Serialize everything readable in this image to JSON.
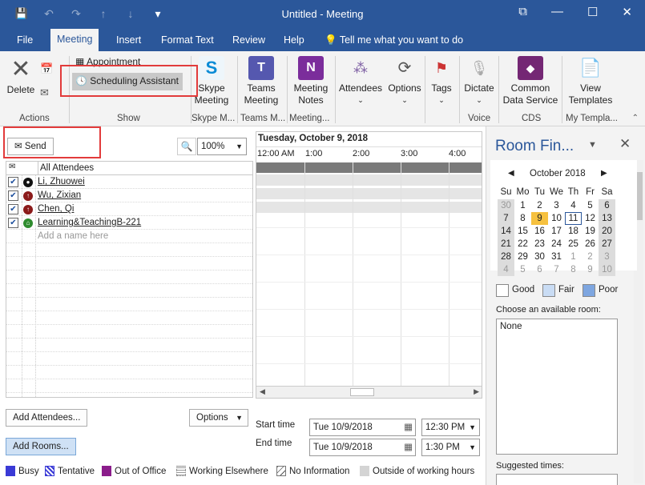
{
  "window": {
    "title": "Untitled  -  Meeting",
    "minimize": "—",
    "restore": "☐",
    "close": "✕",
    "ribbon_display": "⧉"
  },
  "qat": {
    "save": "💾",
    "undo": "↶",
    "redo": "↷",
    "up": "↑",
    "down": "↓",
    "more": "▾"
  },
  "tabs": [
    "File",
    "Meeting",
    "Insert",
    "Format Text",
    "Review",
    "Help"
  ],
  "tell_me": "Tell me what you want to do",
  "ribbon": {
    "delete": "Delete",
    "appointment": "Appointment",
    "scheduling_assistant": "Scheduling Assistant",
    "skype_meeting": [
      "Skype",
      "Meeting"
    ],
    "teams_meeting": [
      "Teams",
      "Meeting"
    ],
    "meeting_notes": [
      "Meeting",
      "Notes"
    ],
    "attendees": "Attendees",
    "options": "Options",
    "tags": "Tags",
    "dictate": "Dictate",
    "common_data": [
      "Common",
      "Data Service"
    ],
    "view_templates": [
      "View",
      "Templates"
    ],
    "groups": [
      "Actions",
      "Show",
      "Skype M...",
      "Teams M...",
      "Meeting...",
      "Voice",
      "CDS",
      "My Templa..."
    ]
  },
  "send": "Send",
  "zoom": "100%",
  "all_attendees": "All Attendees",
  "attendees": [
    {
      "name": "Li, Zhuowei",
      "icon_color": "#111111",
      "icon": "●"
    },
    {
      "name": "Wu, Zixian",
      "icon_color": "#8b1a1a",
      "icon": "↑"
    },
    {
      "name": "Chen, Qi",
      "icon_color": "#8b1a1a",
      "icon": "↑"
    },
    {
      "name": "Learning&TeachingB-221",
      "icon_color": "#2e8b2e",
      "icon": "⌂"
    }
  ],
  "add_name_placeholder": "Add a name here",
  "date_header": "Tuesday, October 9, 2018",
  "times": [
    "12:00 AM",
    "1:00",
    "2:00",
    "3:00",
    "4:00"
  ],
  "buttons": {
    "add_attendees": "Add Attendees...",
    "options": "Options",
    "add_rooms": "Add Rooms..."
  },
  "start_time_label": "Start time",
  "end_time_label": "End time",
  "start_date": "Tue 10/9/2018",
  "start_time": "12:30 PM",
  "end_date": "Tue 10/9/2018",
  "end_time": "1:30 PM",
  "legend": [
    "Busy",
    "Tentative",
    "Out of Office",
    "Working Elsewhere",
    "No Information",
    "Outside of working hours"
  ],
  "colors": {
    "brand": "#2b579a",
    "busy": "#3a3ad6",
    "out_of_office": "#8b1d8b",
    "working_hours": "#d4d4d4"
  },
  "room_finder": {
    "title": "Room Fin...",
    "month": "October 2018",
    "dow": [
      "Su",
      "Mo",
      "Tu",
      "We",
      "Th",
      "Fr",
      "Sa"
    ],
    "weeks": [
      [
        "30",
        "1",
        "2",
        "3",
        "4",
        "5",
        "6"
      ],
      [
        "7",
        "8",
        "9",
        "10",
        "11",
        "12",
        "13"
      ],
      [
        "14",
        "15",
        "16",
        "17",
        "18",
        "19",
        "20"
      ],
      [
        "21",
        "22",
        "23",
        "24",
        "25",
        "26",
        "27"
      ],
      [
        "28",
        "29",
        "30",
        "31",
        "1",
        "2",
        "3"
      ],
      [
        "4",
        "5",
        "6",
        "7",
        "8",
        "9",
        "10"
      ]
    ],
    "good": "Good",
    "fair": "Fair",
    "poor": "Poor",
    "choose_label": "Choose an available room:",
    "room_value": "None",
    "suggested": "Suggested times:"
  }
}
